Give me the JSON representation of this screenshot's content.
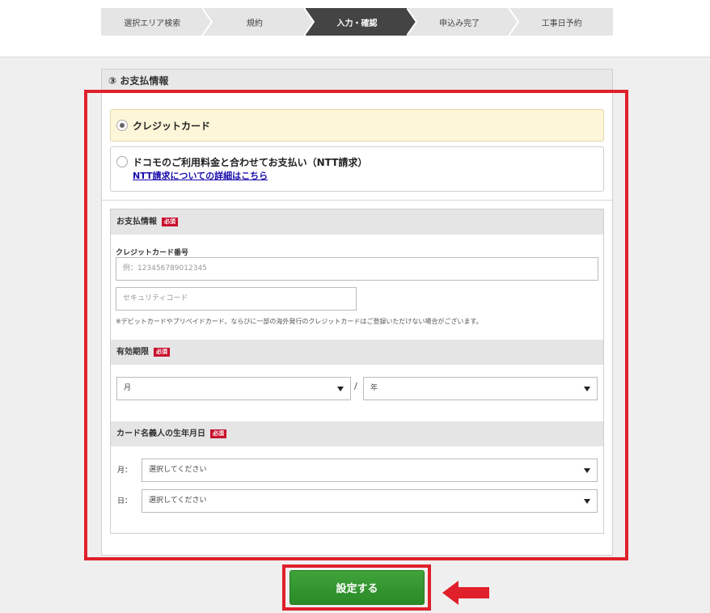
{
  "steps": [
    {
      "label": "選択エリア検索",
      "active": false
    },
    {
      "label": "規約",
      "active": false
    },
    {
      "label": "入力・確認",
      "active": true
    },
    {
      "label": "申込み完了",
      "active": false
    },
    {
      "label": "工事日予約",
      "active": false
    }
  ],
  "section": {
    "title": "③ お支払情報"
  },
  "payment_options": {
    "credit": {
      "label": "クレジットカード",
      "selected": true
    },
    "ntt": {
      "label": "ドコモのご利用料金と合わせてお支払い（NTT請求）",
      "link": "NTT請求についての詳細はこちら",
      "selected": false
    }
  },
  "form": {
    "payment_head": "お支払情報",
    "required": "必須",
    "card_number_label": "クレジットカード番号",
    "card_number_placeholder": "例：123456789012345",
    "security_placeholder": "セキュリティコード",
    "note": "※デビットカードやプリペイドカード、ならびに一部の海外発行のクレジットカードはご登録いただけない場合がございます。",
    "expiry_head": "有効期限",
    "expiry_month": "月",
    "expiry_slash": "/",
    "expiry_year": "年",
    "dob_head": "カード名義人の生年月日",
    "dob_month_label": "月：",
    "dob_day_label": "日：",
    "dob_month_value": "選択してください",
    "dob_day_value": "選択してください"
  },
  "submit": {
    "label": "設定する"
  },
  "colors": {
    "highlight": "#e0202a",
    "button": "#2f9a2c",
    "active_step": "#444444",
    "required": "#c8102e"
  }
}
